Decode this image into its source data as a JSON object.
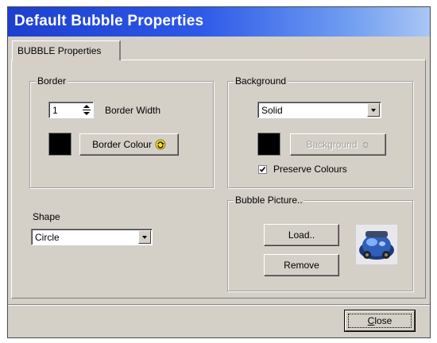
{
  "window": {
    "title": "Default Bubble Properties"
  },
  "tabs": [
    {
      "label": "BUBBLE Properties",
      "active": true
    }
  ],
  "border_group": {
    "label": "Border",
    "width_value": "1",
    "width_label": "Border Width",
    "colour_button_label": "Border Colour",
    "colour_value": "#000000"
  },
  "background_group": {
    "label": "Background",
    "style_value": "Solid",
    "background_button_label": "Background",
    "background_button_enabled": false,
    "colour_value": "#000000",
    "preserve_colours_label": "Preserve Colours",
    "preserve_colours_checked": true
  },
  "shape": {
    "label": "Shape",
    "value": "Circle"
  },
  "picture_group": {
    "label": "Bubble Picture..",
    "load_button_label": "Load..",
    "remove_button_label": "Remove",
    "thumbnail_icon": "blue-car-engine-image"
  },
  "footer": {
    "close_label_accel": "C",
    "close_label_rest": "lose"
  },
  "colors": {
    "titlebar_start": "#1d3fd0",
    "titlebar_end": "#a9c6f5",
    "face": "#d4d0c8"
  }
}
